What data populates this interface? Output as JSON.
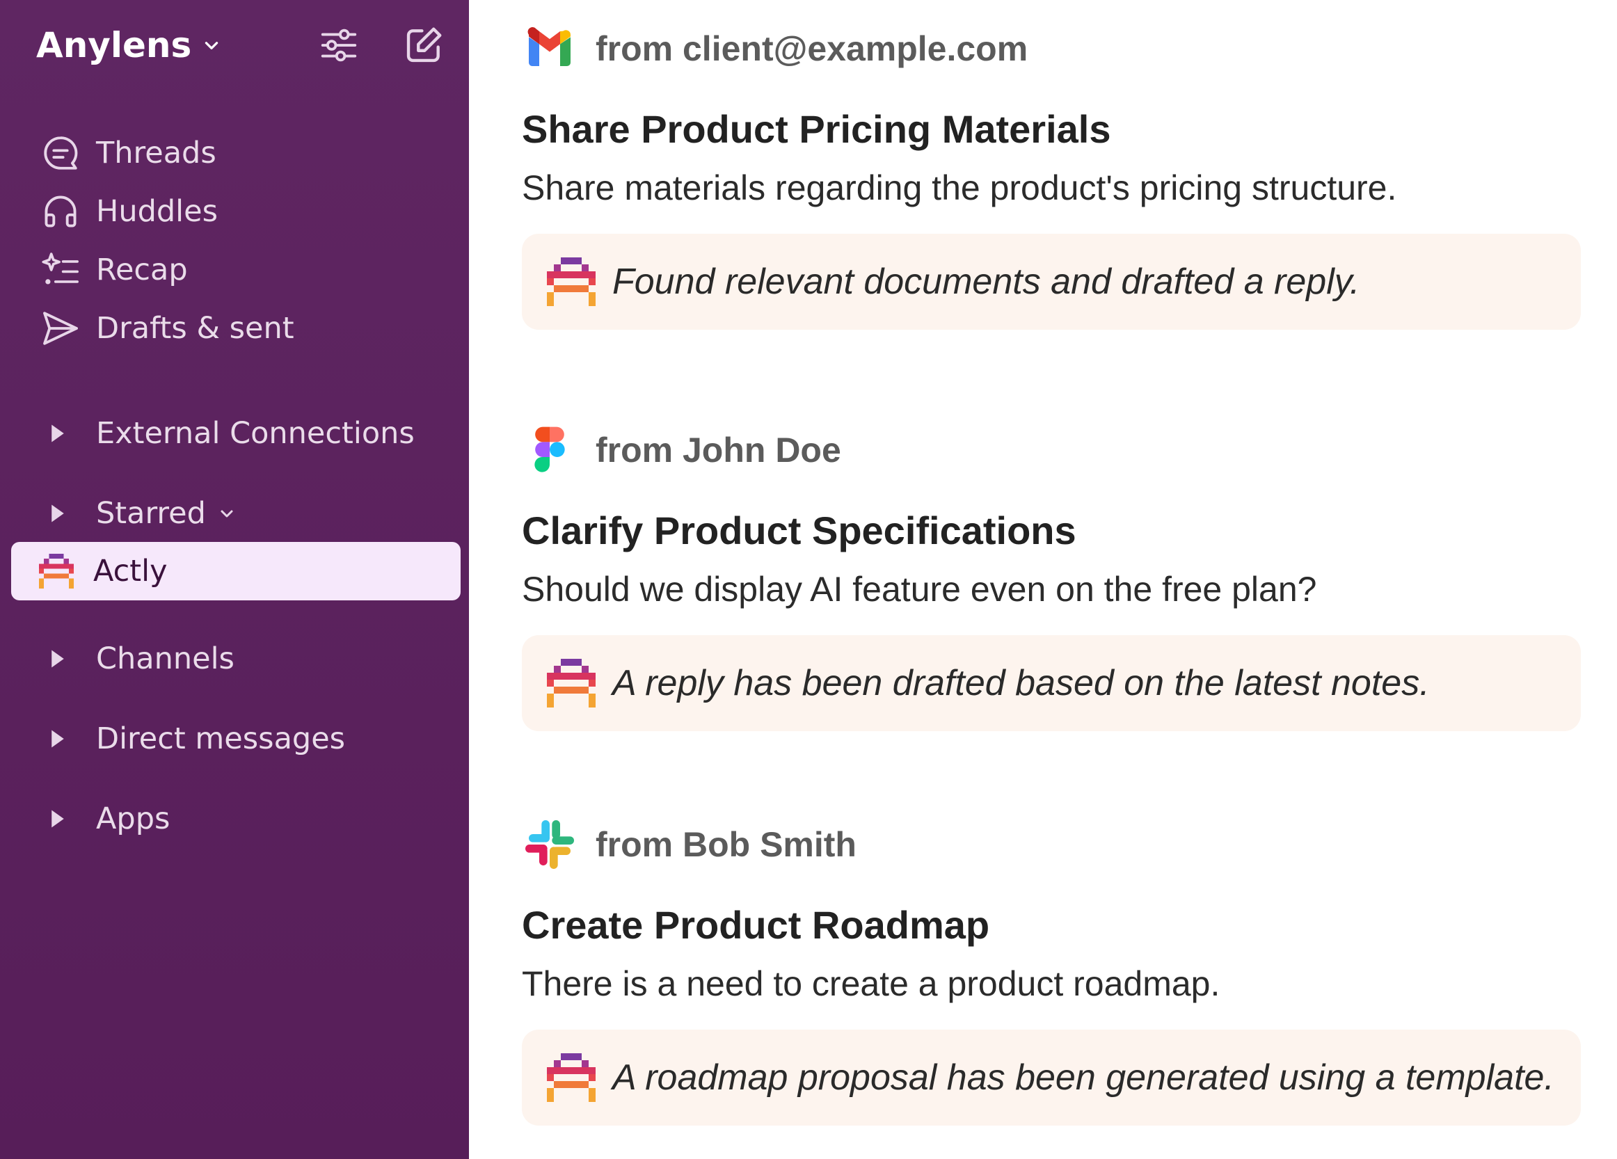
{
  "workspace": {
    "name": "Anylens"
  },
  "sidebar": {
    "nav": [
      {
        "label": "Threads",
        "icon": "threads-icon"
      },
      {
        "label": "Huddles",
        "icon": "headphones-icon"
      },
      {
        "label": "Recap",
        "icon": "sparkle-list-icon"
      },
      {
        "label": "Drafts & sent",
        "icon": "send-icon"
      }
    ],
    "sections": {
      "external": "External Connections",
      "starred": "Starred",
      "selected_item": "Actly",
      "channels": "Channels",
      "direct_messages": "Direct messages",
      "apps": "Apps"
    }
  },
  "colors": {
    "sidebar_bg": "#5f2662",
    "selected_bg": "#f6e8fb",
    "note_bg": "#fdf4ee"
  },
  "messages": [
    {
      "source_icon": "gmail-icon",
      "from": "from client@example.com",
      "title": "Share Product Pricing Materials",
      "description": "Share materials regarding the product's pricing structure.",
      "note": "Found relevant documents and drafted a reply."
    },
    {
      "source_icon": "figma-icon",
      "from": "from John Doe",
      "title": "Clarify Product Specifications",
      "description": "Should we display AI feature even on the free plan?",
      "note": "A reply has been drafted based on the latest notes."
    },
    {
      "source_icon": "slack-icon",
      "from": "from Bob Smith",
      "title": "Create Product Roadmap",
      "description": "There is a need to create a product roadmap.",
      "note": "A roadmap proposal has been generated using a template."
    }
  ]
}
